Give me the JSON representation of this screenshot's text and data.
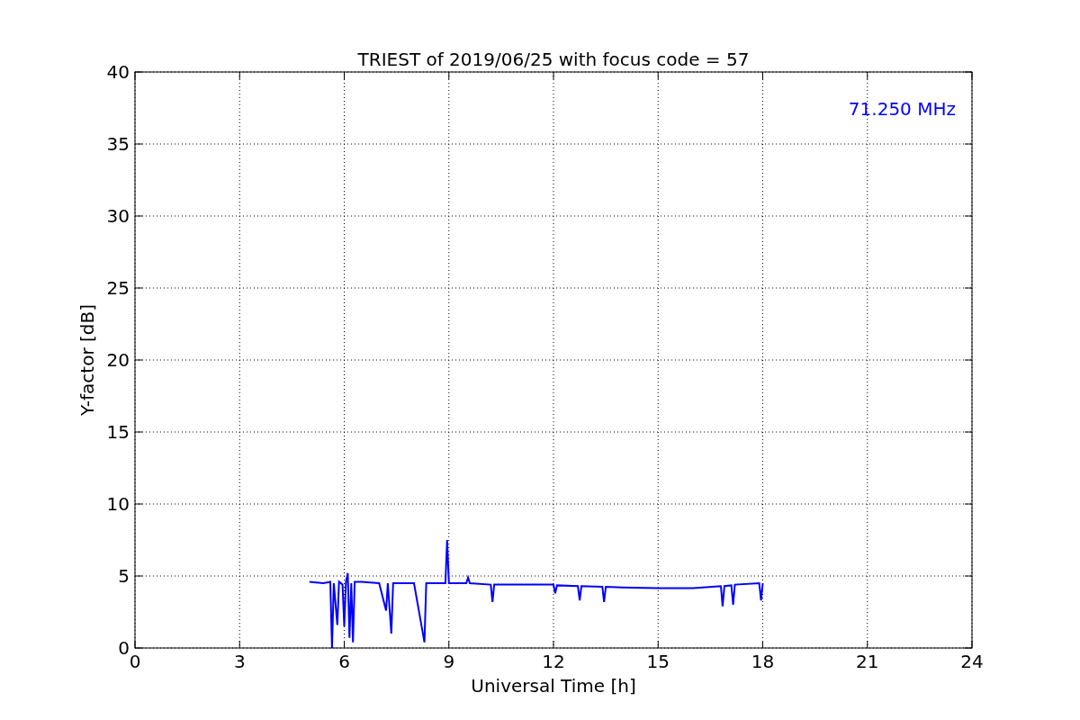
{
  "chart_data": {
    "type": "line",
    "title": "TRIEST of 2019/06/25 with focus code = 57",
    "xlabel": "Universal Time [h]",
    "ylabel": "Y-factor [dB]",
    "x": [
      5.0,
      5.4,
      5.6,
      5.65,
      5.7,
      5.8,
      5.85,
      5.95,
      6.0,
      6.05,
      6.1,
      6.15,
      6.2,
      6.25,
      6.3,
      6.5,
      7.0,
      7.2,
      7.25,
      7.35,
      7.4,
      8.0,
      8.3,
      8.35,
      8.9,
      8.95,
      9.0,
      9.5,
      9.55,
      9.6,
      10.2,
      10.25,
      10.3,
      11.0,
      12.0,
      12.05,
      12.1,
      12.7,
      12.75,
      12.8,
      13.4,
      13.45,
      13.5,
      14.0,
      15.0,
      16.0,
      16.8,
      16.85,
      16.9,
      17.1,
      17.15,
      17.2,
      17.9,
      17.95,
      18.0
    ],
    "series": [
      {
        "name": "71.250 MHz",
        "color": "#0000ff",
        "values": [
          4.6,
          4.5,
          4.6,
          0.0,
          4.5,
          1.6,
          4.6,
          4.4,
          1.5,
          4.6,
          5.2,
          0.7,
          4.5,
          0.4,
          4.6,
          4.6,
          4.5,
          2.6,
          4.5,
          1.0,
          4.5,
          4.5,
          0.4,
          4.5,
          4.5,
          7.5,
          4.5,
          4.5,
          4.9,
          4.5,
          4.4,
          3.2,
          4.4,
          4.4,
          4.4,
          3.8,
          4.35,
          4.3,
          3.3,
          4.3,
          4.25,
          3.2,
          4.25,
          4.2,
          4.15,
          4.15,
          4.3,
          2.9,
          4.3,
          4.35,
          3.0,
          4.4,
          4.5,
          3.3,
          4.5
        ]
      }
    ],
    "xlim": [
      0,
      24
    ],
    "ylim": [
      0,
      40
    ],
    "grid": true,
    "xticks": [
      0,
      3,
      6,
      9,
      12,
      15,
      18,
      21,
      24
    ],
    "yticks": [
      0,
      5,
      10,
      15,
      20,
      25,
      30,
      35,
      40
    ]
  }
}
